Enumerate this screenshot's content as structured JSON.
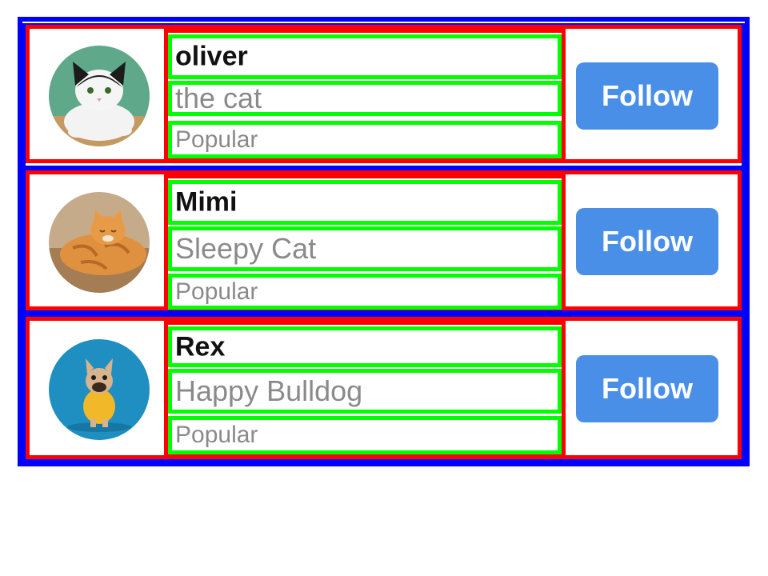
{
  "colors": {
    "button": "#4a8fe7",
    "outline_blue": "#0000ff",
    "outline_red": "#ff0000",
    "outline_green": "#00ff00"
  },
  "users": [
    {
      "name": "oliver",
      "description": "the cat",
      "tag": "Popular",
      "follow_label": "Follow",
      "avatar": "black-white-cat-photo"
    },
    {
      "name": "Mimi",
      "description": "Sleepy Cat",
      "tag": "Popular",
      "follow_label": "Follow",
      "avatar": "orange-sleeping-cat-photo"
    },
    {
      "name": "Rex",
      "description": "Happy Bulldog",
      "tag": "Popular",
      "follow_label": "Follow",
      "avatar": "bulldog-yellow-shirt-photo"
    }
  ]
}
